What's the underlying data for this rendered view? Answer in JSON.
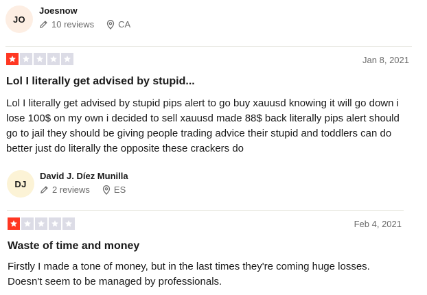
{
  "colors": {
    "star_filled_bg": "#ff3722",
    "star_empty_bg": "#dcdce6",
    "star_glyph": "#ffffff",
    "avatar1_bg": "#fdeee3",
    "avatar2_bg": "#fcf3d6",
    "meta_text": "#6b6b6b"
  },
  "reviews": [
    {
      "avatar_initials": "JO",
      "reviewer_name": "Joesnow",
      "reviews_count": "10 reviews",
      "location": "CA",
      "rating": 1,
      "date": "Jan 8, 2021",
      "title": "Lol I literally get advised by stupid...",
      "body": "Lol I literally get advised by stupid pips alert to go buy xauusd knowing it will go down i lose 100$ on my own i decided to sell xauusd made 88$ back literally pips alert should go to jail they should be giving people trading advice their stupid and toddlers can do better just do literally the opposite these crackers do"
    },
    {
      "avatar_initials": "DJ",
      "reviewer_name": "David J. Díez Munilla",
      "reviews_count": "2 reviews",
      "location": "ES",
      "rating": 1,
      "date": "Feb 4, 2021",
      "title": "Waste of time and money",
      "body": "Firstly I made a tone of money, but in the last times they're coming huge losses. Doesn't seem to be managed by professionals."
    }
  ]
}
